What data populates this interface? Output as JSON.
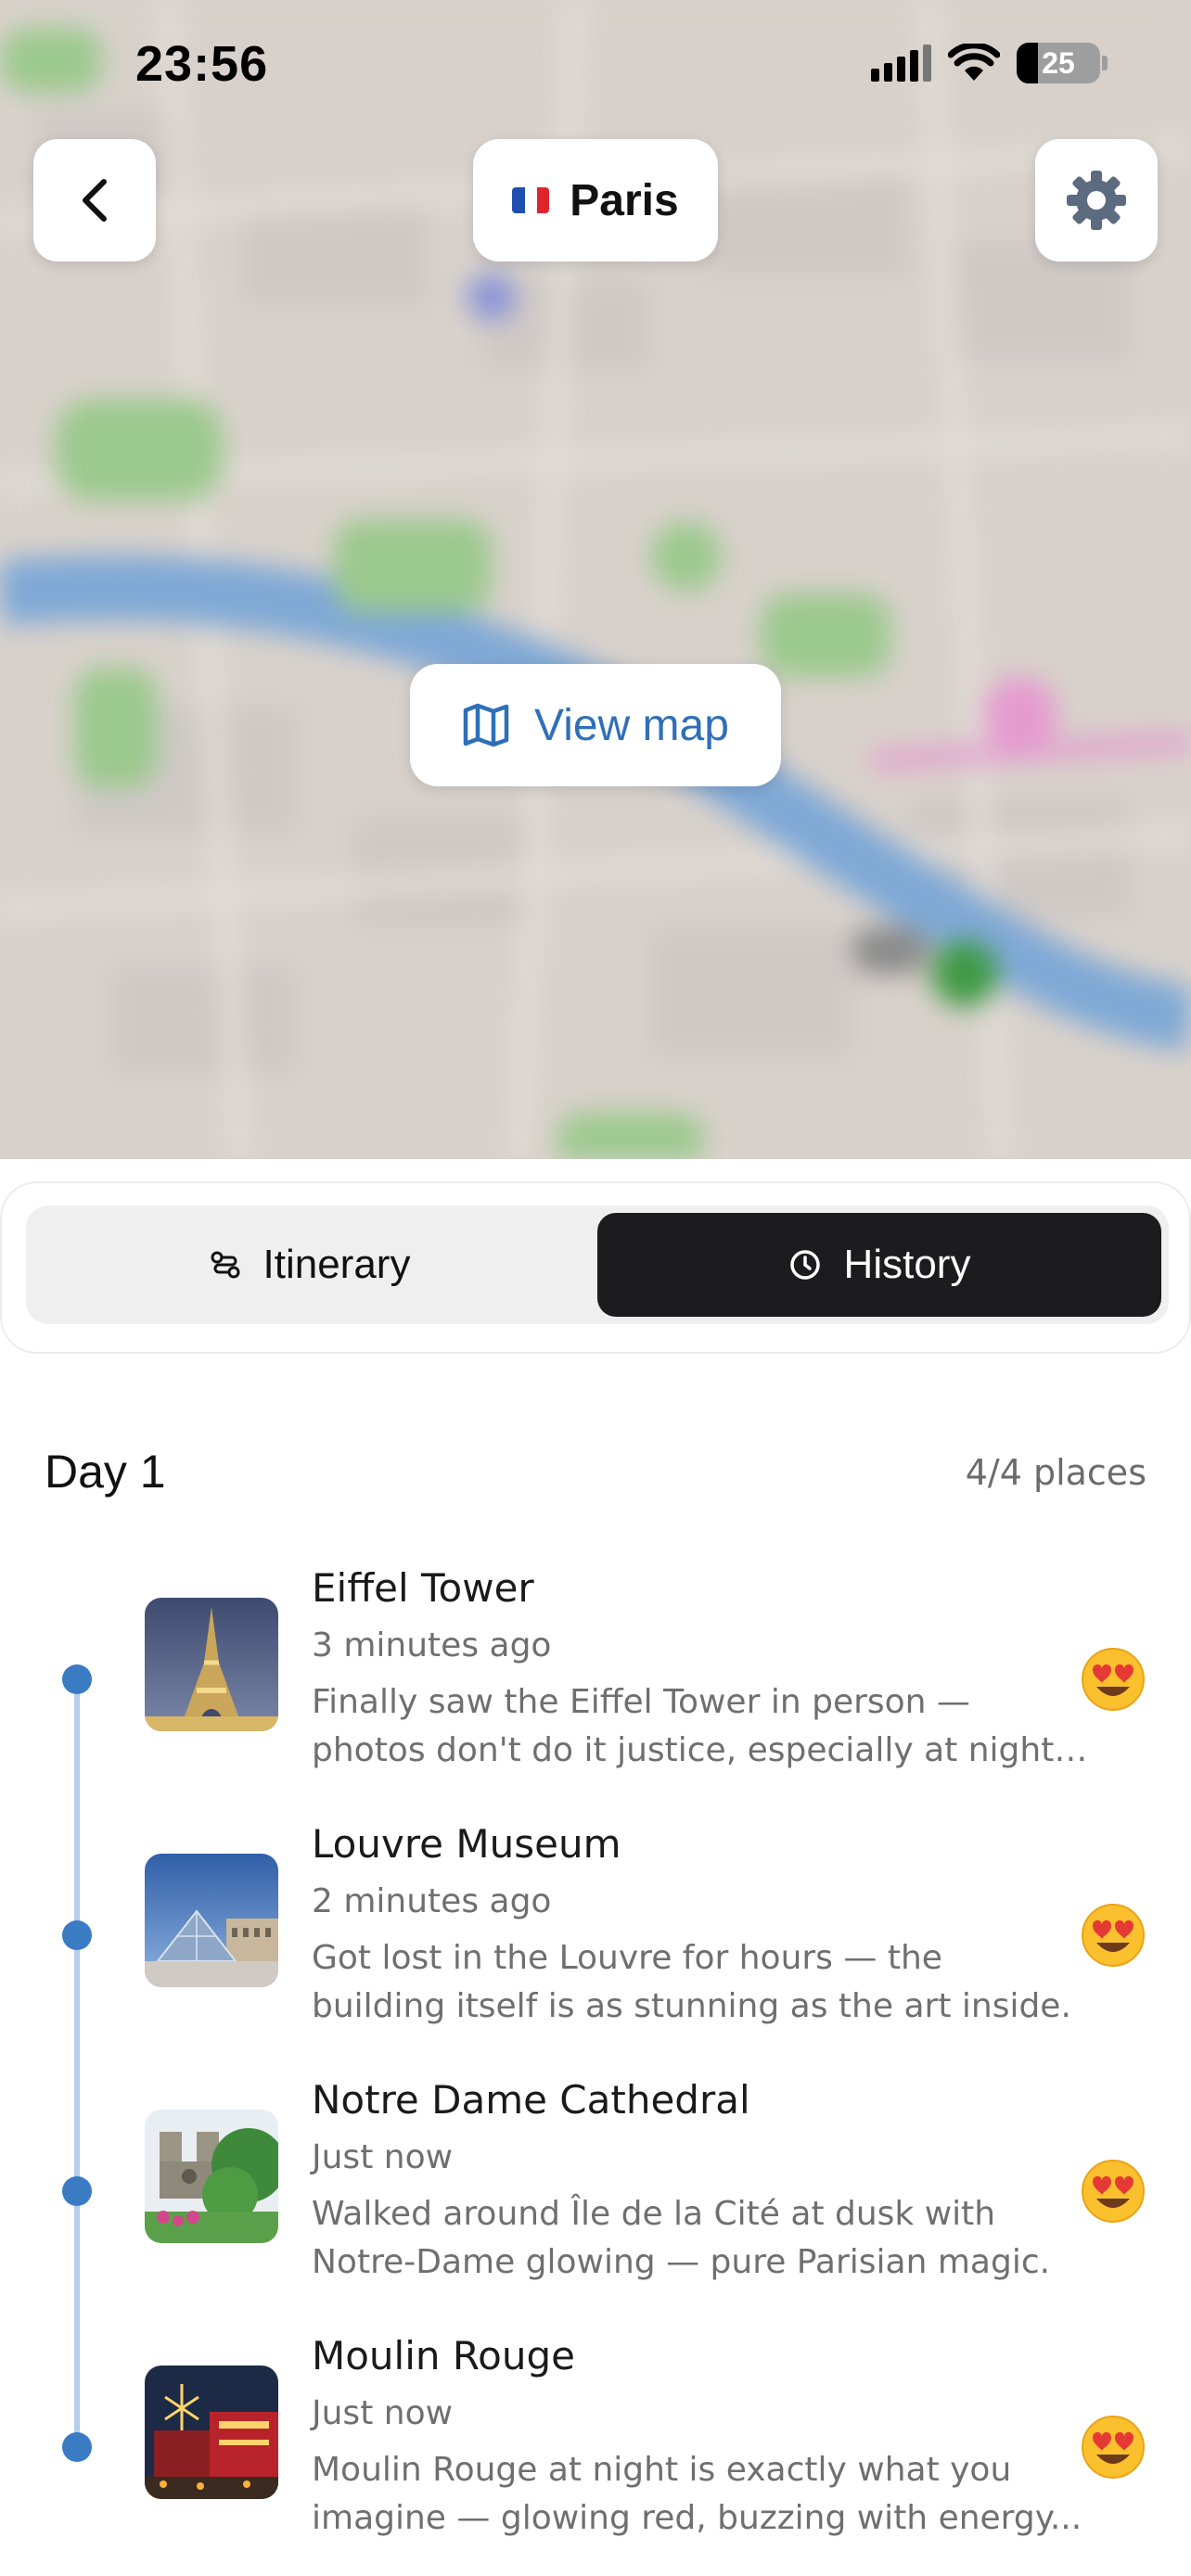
{
  "status_bar": {
    "time": "23:56",
    "battery": "25"
  },
  "header": {
    "city": "Paris",
    "flag_colors": [
      "#1f4fb0",
      "#ffffff",
      "#e0242c"
    ],
    "back_icon": "chevron-left-icon",
    "settings_icon": "gear-icon"
  },
  "map": {
    "view_map_label": "View map",
    "view_map_icon": "map-icon"
  },
  "tabs": [
    {
      "label": "Itinerary",
      "icon": "route-icon",
      "selected": false
    },
    {
      "label": "History",
      "icon": "clock-icon",
      "selected": true
    }
  ],
  "day": {
    "title": "Day 1",
    "count": "4/4 places"
  },
  "entries": [
    {
      "place": "Eiffel Tower",
      "time": "3 minutes ago",
      "note_line1": "Finally saw the Eiffel Tower in person —",
      "note_line2": "photos don't do it justice, especially at night ...",
      "emoji": "heart-eyes-emoji"
    },
    {
      "place": "Louvre Museum",
      "time": "2 minutes ago",
      "note_line1": "Got lost in the Louvre for hours — the",
      "note_line2": "building itself is as stunning as the art inside.",
      "emoji": "heart-eyes-emoji"
    },
    {
      "place": "Notre Dame Cathedral",
      "time": "Just now",
      "note_line1": "Walked around Île de la Cité at dusk with",
      "note_line2": "Notre-Dame glowing — pure Parisian magic.",
      "emoji": "heart-eyes-emoji"
    },
    {
      "place": "Moulin Rouge",
      "time": "Just now",
      "note_line1": "Moulin Rouge at night is exactly what you",
      "note_line2": "imagine — glowing red, buzzing with energy...",
      "emoji": "heart-eyes-emoji"
    }
  ]
}
